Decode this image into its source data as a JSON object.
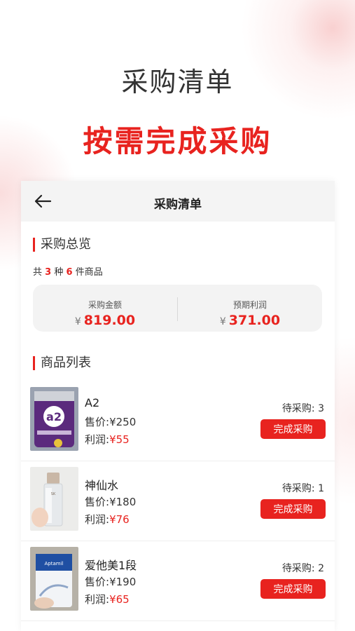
{
  "hero": {
    "title": "采购清单",
    "subtitle": "按需完成采购"
  },
  "navbar": {
    "title": "采购清单"
  },
  "overview": {
    "section_title": "采购总览",
    "count_prefix": "共",
    "kinds": "3",
    "kinds_suffix": "种",
    "items": "6",
    "items_suffix": "件商品",
    "amount_label": "采购金额",
    "amount_currency": "¥",
    "amount_value": "819.00",
    "profit_label": "预期利润",
    "profit_currency": "¥",
    "profit_value": "371.00"
  },
  "products": {
    "section_title": "商品列表",
    "items": [
      {
        "name": "A2",
        "price_label": "售价:",
        "price": "¥250",
        "profit_label": "利润:",
        "profit": "¥55",
        "pending": "待采购: 3",
        "button": "完成采购"
      },
      {
        "name": "神仙水",
        "price_label": "售价:",
        "price": "¥180",
        "profit_label": "利润:",
        "profit": "¥76",
        "pending": "待采购: 1",
        "button": "完成采购"
      },
      {
        "name": "爱他美1段",
        "price_label": "售价:",
        "price": "¥190",
        "profit_label": "利润:",
        "profit": "¥65",
        "pending": "待采购: 2",
        "button": "完成采购"
      }
    ]
  },
  "colors": {
    "accent": "#e8231f",
    "text": "#333333",
    "card": "#f3f3f3"
  }
}
